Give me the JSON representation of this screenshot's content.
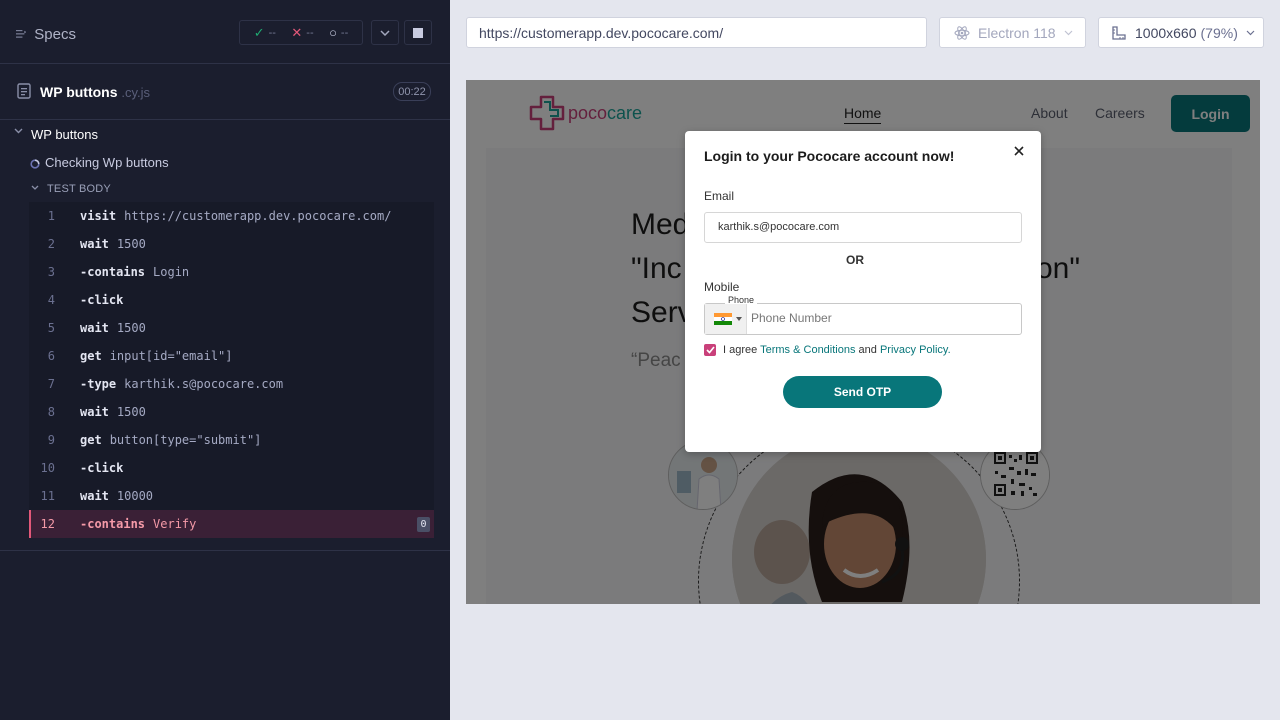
{
  "runner": {
    "specs_label": "Specs",
    "stats": {
      "passed": "--",
      "failed": "--",
      "pending": "--"
    },
    "spec": {
      "name": "WP buttons",
      "ext": ".cy.js",
      "duration": "00:22"
    },
    "suite_title": "WP buttons",
    "test_title": "Checking Wp buttons",
    "body_label": "TEST BODY",
    "commands": [
      {
        "num": "1",
        "name": "visit",
        "message": "https://customerapp.dev.pococare.com/",
        "state": "passed"
      },
      {
        "num": "2",
        "name": "wait",
        "message": "1500",
        "state": "passed"
      },
      {
        "num": "3",
        "name": "-contains",
        "message": "Login",
        "state": "passed"
      },
      {
        "num": "4",
        "name": "-click",
        "message": "",
        "state": "passed"
      },
      {
        "num": "5",
        "name": "wait",
        "message": "1500",
        "state": "passed"
      },
      {
        "num": "6",
        "name": "get",
        "message": "input[id=\"email\"]",
        "state": "passed"
      },
      {
        "num": "7",
        "name": "-type",
        "message": "karthik.s@pococare.com",
        "state": "passed"
      },
      {
        "num": "8",
        "name": "wait",
        "message": "1500",
        "state": "passed"
      },
      {
        "num": "9",
        "name": "get",
        "message": "button[type=\"submit\"]",
        "state": "passed"
      },
      {
        "num": "10",
        "name": "-click",
        "message": "",
        "state": "passed"
      },
      {
        "num": "11",
        "name": "wait",
        "message": "10000",
        "state": "passed"
      },
      {
        "num": "12",
        "name": "-contains",
        "message": "Verify",
        "state": "failed",
        "badge": "0"
      }
    ]
  },
  "toolbar": {
    "url": "https://customerapp.dev.pococare.com/",
    "browser": "Electron 118",
    "viewport": "1000x660",
    "zoom": "(79%)"
  },
  "site": {
    "logo_part1": "poco",
    "logo_part2": "care",
    "nav": {
      "home": "Home",
      "about": "About",
      "careers": "Careers",
      "login": "Login"
    },
    "hero_line1": "Med",
    "hero_line2": "\"Inc",
    "hero_line2_end": "on\"",
    "hero_line3": "Serv",
    "hero_sub": "“Peac"
  },
  "modal": {
    "title": "Login to your Pococare account now!",
    "email_label": "Email",
    "email_value": "karthik.s@pococare.com",
    "or": "OR",
    "mobile_label": "Mobile",
    "phone_legend": "Phone",
    "phone_placeholder": "Phone Number",
    "agree_prefix": "I agree",
    "terms": "Terms & Conditions",
    "and": "and",
    "privacy": "Privacy Policy.",
    "send_otp": "Send OTP"
  },
  "colors": {
    "brand_teal": "#08767a",
    "brand_pink": "#c9407a",
    "runner_bg": "#1b1e2e",
    "failed": "#e25879"
  }
}
